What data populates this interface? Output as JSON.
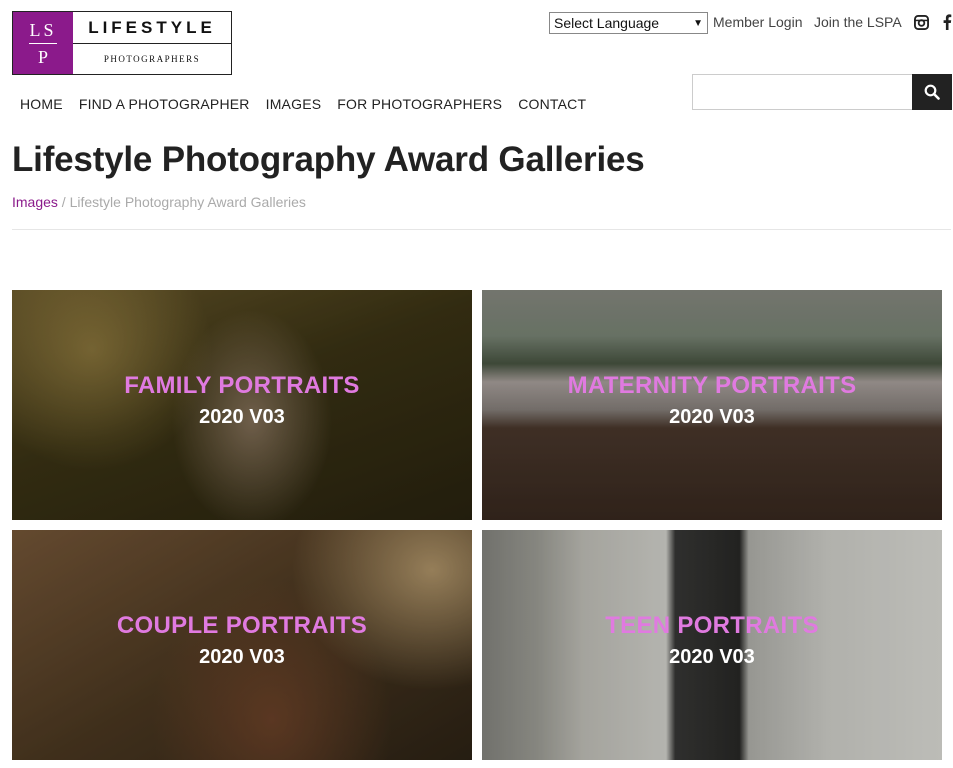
{
  "logo": {
    "mark_line1": "LS",
    "mark_line2": "P",
    "title": "LIFESTYLE",
    "subtitle": "PHOTOGRAPHERS",
    "brand_color": "#8b1a8b"
  },
  "topbar": {
    "language_select": "Select Language",
    "member_login": "Member Login",
    "join": "Join the LSPA",
    "social_icons": [
      "instagram-icon",
      "facebook-icon"
    ]
  },
  "nav": {
    "items": [
      {
        "label": "HOME"
      },
      {
        "label": "FIND A PHOTOGRAPHER"
      },
      {
        "label": "IMAGES"
      },
      {
        "label": "FOR PHOTOGRAPHERS"
      },
      {
        "label": "CONTACT"
      }
    ]
  },
  "search": {
    "value": "",
    "placeholder": "",
    "icon": "search-icon"
  },
  "page": {
    "title": "Lifestyle Photography Award Galleries",
    "breadcrumb": {
      "link": "Images",
      "separator": " / ",
      "current": "Lifestyle Photography Award Galleries"
    }
  },
  "galleries": [
    {
      "title": "FAMILY PORTRAITS",
      "subtitle": "2020 V03"
    },
    {
      "title": "MATERNITY PORTRAITS",
      "subtitle": "2020 V03"
    },
    {
      "title": "COUPLE PORTRAITS",
      "subtitle": "2020 V03"
    },
    {
      "title": "TEEN PORTRAITS",
      "subtitle": "2020 V03"
    }
  ],
  "colors": {
    "accent": "#8b1a8b",
    "gallery_title": "#e07ae0",
    "search_button": "#222222"
  }
}
